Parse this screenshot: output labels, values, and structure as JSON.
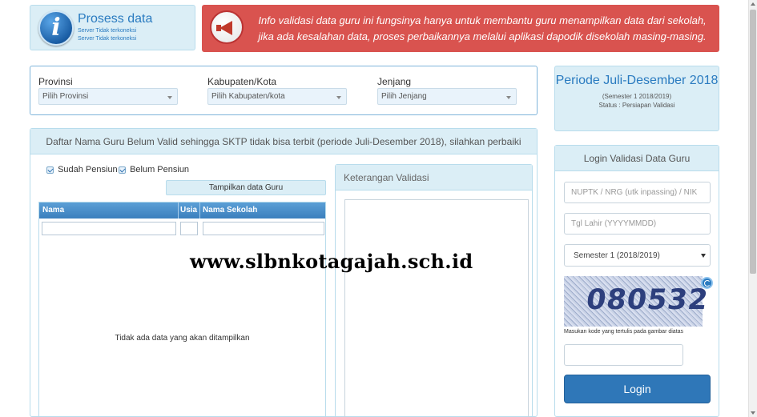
{
  "status": {
    "title": "Prosess data",
    "lines": [
      "Server Tidak terkoneksi",
      "Server Tidak terkoneksi"
    ],
    "icon": "info-icon"
  },
  "alert": {
    "icon": "megaphone-icon",
    "text": "Info validasi data guru ini fungsinya hanya untuk membantu guru menampilkan data dari sekolah, jika ada kesalahan data, proses perbaikannya melalui aplikasi dapodik disekolah masing-masing.",
    "color": "#d9534f"
  },
  "filters": {
    "provinsi": {
      "label": "Provinsi",
      "value": "Pilih Provinsi"
    },
    "kabupaten": {
      "label": "Kabupaten/Kota",
      "value": "Pilih Kabupaten/kota"
    },
    "jenjang": {
      "label": "Jenjang",
      "value": "Pilih Jenjang"
    }
  },
  "period": {
    "title": "Periode Juli-Desember 2018",
    "semester": "(Semester 1 2018/2019)",
    "status": "Status : Persiapan Validasi"
  },
  "list": {
    "header": "Daftar Nama Guru Belum Valid sehingga SKTP tidak bisa terbit (periode Juli-Desember 2018), silahkan perbaiki",
    "checks": [
      {
        "label": "Sudah Pensiun",
        "checked": true
      },
      {
        "label": "Belum Pensiun",
        "checked": true
      }
    ],
    "show_button": "Tampilkan data Guru",
    "columns": [
      "Nama",
      "Usia",
      "Nama Sekolah"
    ],
    "empty_message": "Tidak ada data yang akan ditampilkan"
  },
  "keterangan": {
    "header": "Keterangan Validasi"
  },
  "login": {
    "header": "Login Validasi Data Guru",
    "nuptk_placeholder": "NUPTK / NRG (utk inpassing) / NIK",
    "tgl_placeholder": "Tgl Lahir (YYYYMMDD)",
    "semester_value": "Semester 1 (2018/2019)",
    "captcha_text": "080532",
    "captcha_hint": "Masukan kode yang tertulis pada gambar diatas",
    "button": "Login",
    "accent": "#2f77b8"
  },
  "watermark": "www.slbnkotagajah.sch.id"
}
